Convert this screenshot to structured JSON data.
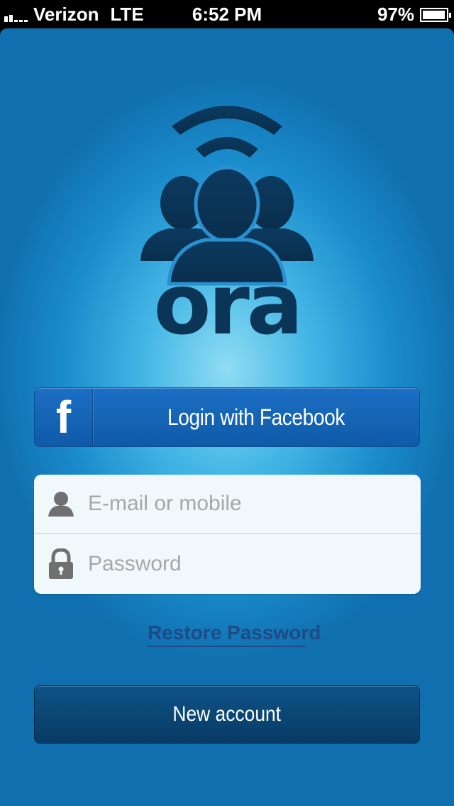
{
  "status_bar": {
    "carrier": "Verizon",
    "network": "LTE",
    "time": "6:52 PM",
    "battery_percent": "97%",
    "battery_level": 0.97
  },
  "app": {
    "logo_text": "ora",
    "logo_icon": "group-broadcast-icon",
    "colors": {
      "background_top": "#106fae",
      "background_glow": "#8fdcf3",
      "logo_dark": "#0b3557",
      "facebook_blue": "#1863b8",
      "new_account_navy": "#083b64"
    }
  },
  "facebook": {
    "icon": "facebook-f-icon",
    "icon_glyph": "f",
    "label": "Login with Facebook"
  },
  "login": {
    "email_placeholder": "E-mail or mobile",
    "email_icon": "person-icon",
    "password_placeholder": "Password",
    "password_icon": "lock-icon"
  },
  "restore_link": "Restore Password",
  "new_account_label": "New account"
}
